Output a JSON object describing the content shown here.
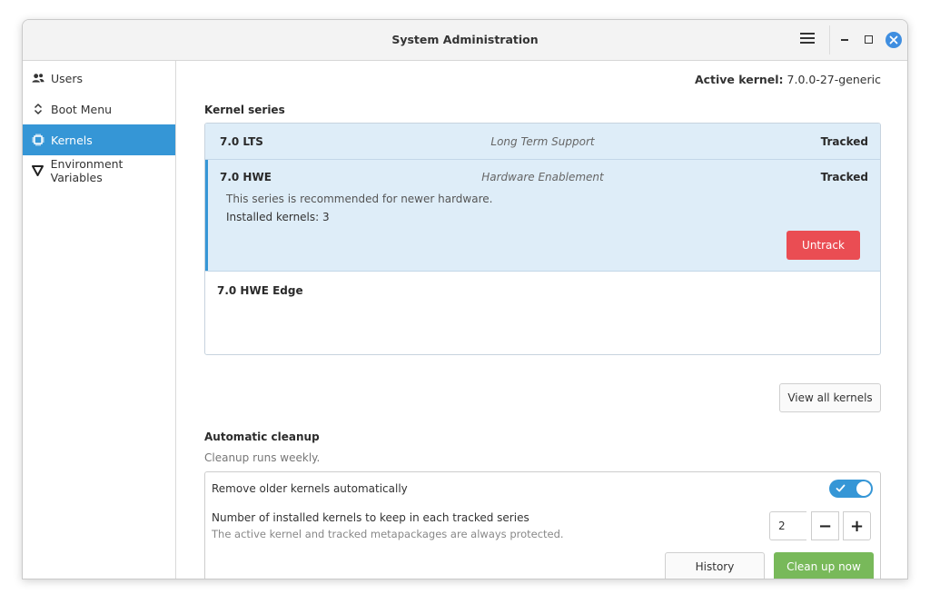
{
  "window": {
    "title": "System Administration"
  },
  "sidebar": {
    "items": [
      {
        "label": "Users",
        "icon": "users-icon"
      },
      {
        "label": "Boot Menu",
        "icon": "boot-menu-icon"
      },
      {
        "label": "Kernels",
        "icon": "chip-icon",
        "active": true
      },
      {
        "label": "Environment Variables",
        "icon": "env-var-icon"
      }
    ]
  },
  "header": {
    "active_kernel_label": "Active kernel:",
    "active_kernel_value": "7.0.0-27-generic"
  },
  "kernel_series": {
    "title": "Kernel series",
    "rows": [
      {
        "name": "7.0 LTS",
        "description": "Long Term Support",
        "status": "Tracked"
      },
      {
        "name": "7.0 HWE",
        "description": "Hardware Enablement",
        "status": "Tracked",
        "detail": "This series is recommended for newer hardware.",
        "installed": "Installed kernels: 3",
        "action": "Untrack"
      },
      {
        "name": "7.0 HWE Edge"
      }
    ],
    "view_all_label": "View all kernels"
  },
  "cleanup": {
    "title": "Automatic cleanup",
    "subtitle": "Cleanup runs weekly.",
    "auto_remove_label": "Remove older kernels automatically",
    "auto_remove_enabled": true,
    "keep_label": "Number of installed kernels to keep in each tracked series",
    "keep_sub": "The active kernel and tracked metapackages are always protected.",
    "keep_value": "2",
    "minus_label": "−",
    "plus_label": "+",
    "history_label": "History",
    "clean_label": "Clean up now"
  },
  "colors": {
    "accent": "#3596d6",
    "danger": "#ea4d53",
    "success": "#78b95a"
  }
}
